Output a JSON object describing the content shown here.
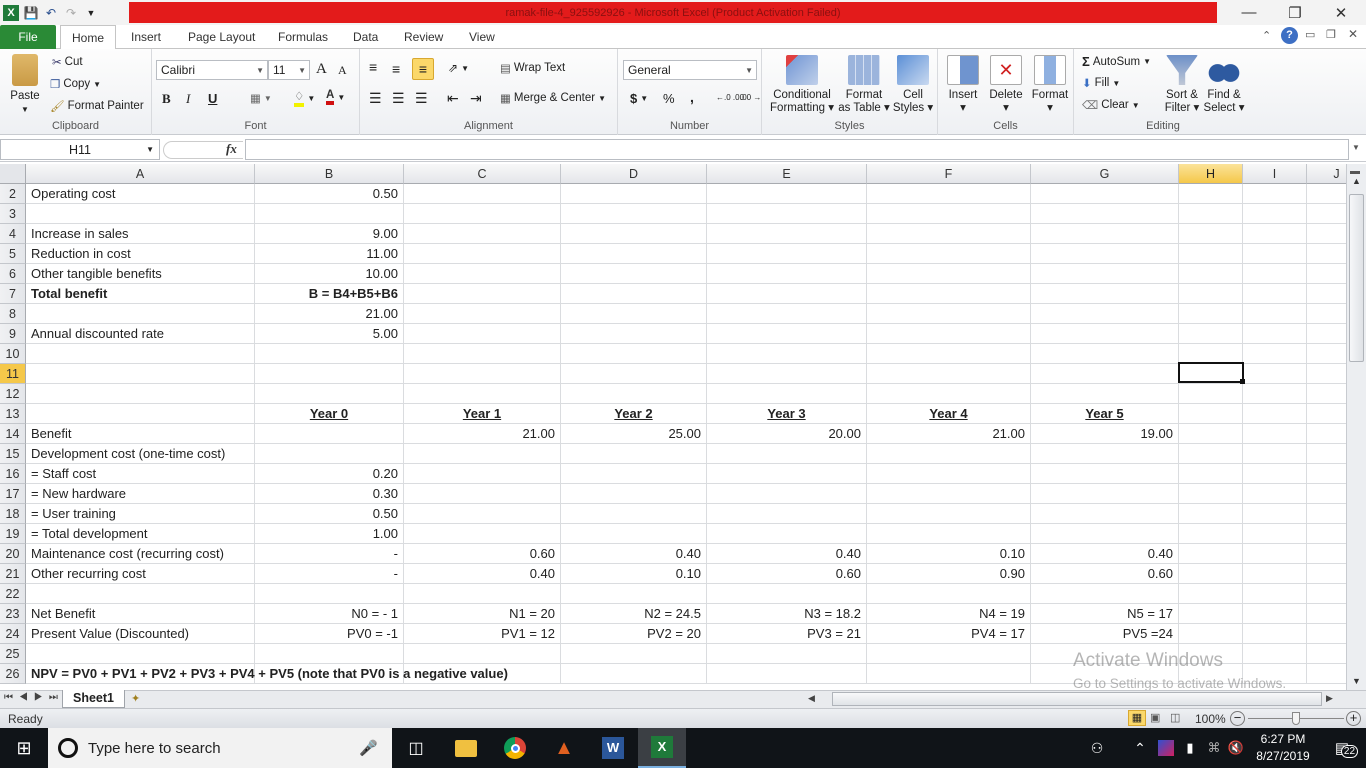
{
  "window": {
    "title": "ramak-file-4_925592926 - Microsoft Excel (Product Activation Failed)",
    "controls": {
      "minimize": "—",
      "restore": "❐",
      "close": "✕"
    }
  },
  "quick_access": {
    "icons": [
      "excel-logo-icon",
      "save-icon",
      "undo-icon",
      "redo-icon",
      "customize-icon"
    ]
  },
  "ribbon_tabs": [
    "File",
    "Home",
    "Insert",
    "Page Layout",
    "Formulas",
    "Data",
    "Review",
    "View"
  ],
  "active_tab": "Home",
  "ribbon": {
    "clipboard": {
      "label": "Clipboard",
      "paste": "Paste",
      "cut": "Cut",
      "copy": "Copy",
      "format_painter": "Format Painter"
    },
    "font": {
      "label": "Font",
      "font_name": "Calibri",
      "font_size": "11",
      "bold": "B",
      "italic": "I",
      "underline": "U",
      "grow": "A",
      "shrink": "A"
    },
    "alignment": {
      "label": "Alignment",
      "wrap_text": "Wrap Text",
      "merge_center": "Merge & Center"
    },
    "number": {
      "label": "Number",
      "format": "General",
      "currency": "$",
      "percent": "%",
      "comma": ",",
      "inc_decimal": "←.0 .00",
      "dec_decimal": ".00 →.0"
    },
    "styles": {
      "label": "Styles",
      "conditional": [
        "Conditional",
        "Formatting"
      ],
      "format_table": [
        "Format",
        "as Table"
      ],
      "cell_styles": [
        "Cell",
        "Styles"
      ]
    },
    "cells": {
      "label": "Cells",
      "insert": "Insert",
      "delete": "Delete",
      "format": "Format"
    },
    "editing": {
      "label": "Editing",
      "autosum": "AutoSum",
      "fill": "Fill",
      "clear": "Clear",
      "sort_filter": [
        "Sort &",
        "Filter"
      ],
      "find_select": [
        "Find &",
        "Select"
      ]
    }
  },
  "formula_bar": {
    "name_box": "H11",
    "fx": "fx",
    "formula": ""
  },
  "columns": [
    "A",
    "B",
    "C",
    "D",
    "E",
    "F",
    "G",
    "H",
    "I",
    "J"
  ],
  "selected_column": "H",
  "selected_row": "11",
  "rows": [
    {
      "n": "2",
      "cells": {
        "A": "Operating cost",
        "B": "0.50"
      }
    },
    {
      "n": "3",
      "cells": {}
    },
    {
      "n": "4",
      "cells": {
        "A": "Increase in sales",
        "B": "9.00"
      }
    },
    {
      "n": "5",
      "cells": {
        "A": "Reduction in cost",
        "B": "11.00"
      }
    },
    {
      "n": "6",
      "cells": {
        "A": "Other tangible benefits",
        "B": "10.00"
      }
    },
    {
      "n": "7",
      "cells": {
        "A": "Total benefit",
        "B": "B = B4+B5+B6"
      }
    },
    {
      "n": "8",
      "cells": {
        "B": "21.00"
      }
    },
    {
      "n": "9",
      "cells": {
        "A": "Annual discounted rate",
        "B": "5.00"
      }
    },
    {
      "n": "10",
      "cells": {}
    },
    {
      "n": "11",
      "cells": {}
    },
    {
      "n": "12",
      "cells": {}
    },
    {
      "n": "13",
      "cells": {
        "B": "Year 0",
        "C": "Year 1",
        "D": "Year 2",
        "E": "Year 3",
        "F": "Year 4",
        "G": "Year 5"
      }
    },
    {
      "n": "14",
      "cells": {
        "A": " Benefit",
        "C": "21.00",
        "D": "25.00",
        "E": "20.00",
        "F": "21.00",
        "G": "19.00"
      }
    },
    {
      "n": "15",
      "cells": {
        "A": " Development cost (one-time cost)"
      }
    },
    {
      "n": "16",
      "cells": {
        "A": "  = Staff cost",
        "B": "0.20"
      }
    },
    {
      "n": "17",
      "cells": {
        "A": " = New hardware",
        "B": "0.30"
      }
    },
    {
      "n": "18",
      "cells": {
        "A": " = User training",
        "B": "0.50"
      }
    },
    {
      "n": "19",
      "cells": {
        "A": " = Total development",
        "B": "1.00"
      }
    },
    {
      "n": "20",
      "cells": {
        "A": " Maintenance cost (recurring cost)",
        "B": "-",
        "C": "0.60",
        "D": "0.40",
        "E": "0.40",
        "F": "0.10",
        "G": "0.40"
      }
    },
    {
      "n": "21",
      "cells": {
        "A": " Other recurring cost",
        "B": "-",
        "C": "0.40",
        "D": "0.10",
        "E": "0.60",
        "F": "0.90",
        "G": "0.60"
      }
    },
    {
      "n": "22",
      "cells": {}
    },
    {
      "n": "23",
      "cells": {
        "A": " Net Benefit",
        "B": "N0 = - 1",
        "C": "N1 = 20",
        "D": "N2 = 24.5",
        "E": "N3 = 18.2",
        "F": "N4 = 19",
        "G": "N5 = 17"
      }
    },
    {
      "n": "24",
      "cells": {
        "A": " Present Value (Discounted)",
        "B": "PV0 = -1",
        "C": "PV1 = 12",
        "D": "PV2 = 20",
        "E": "PV3 = 21",
        "F": "PV4 = 17",
        "G": "PV5 =24"
      }
    },
    {
      "n": "25",
      "cells": {}
    },
    {
      "n": "26",
      "cells": {
        "A": " NPV = PV0 + PV1 + PV2 + PV3 + PV4 + PV5 (note that PV0 is a negative value)"
      }
    }
  ],
  "bold_rows": [
    "7",
    "13",
    "26"
  ],
  "sheet_tabs": [
    "Sheet1"
  ],
  "status": {
    "ready": "Ready",
    "zoom": "100%",
    "zoom_level_percent": 100
  },
  "watermark": {
    "line1": "Activate Windows",
    "line2": "Go to Settings to activate Windows."
  },
  "taskbar": {
    "search_placeholder": "Type here to search",
    "apps": [
      "task-view",
      "file-explorer",
      "chrome",
      "matlab",
      "word",
      "excel"
    ],
    "time": "6:27 PM",
    "date": "8/27/2019",
    "notifications": "22"
  },
  "colors": {
    "accent_file_tab": "#2a8a36",
    "title_bar_red": "#e31b1b",
    "selected_header": "#f5c84a"
  }
}
